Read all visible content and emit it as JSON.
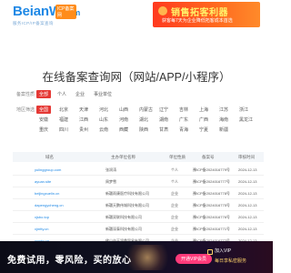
{
  "header": {
    "logo": "BeianW",
    "logo_suffix": ".com",
    "logo_tag": "ICP备案网",
    "logo_sub": "服务ICP/IP备案查询"
  },
  "top_banner": {
    "title": "销售拓客利器",
    "subtitle": "获客每7天为企业降低拓客成本首选"
  },
  "main_title": "在线备案查询网（网站/APP/小程序）",
  "filters": {
    "type_label": "备案性质",
    "types": [
      "全部",
      "个人",
      "企业",
      "事业单位"
    ],
    "region_label": "地区筛选",
    "regions": [
      "全国",
      "北京",
      "天津",
      "河北",
      "山西",
      "内蒙古",
      "辽宁",
      "吉林",
      "上海",
      "江苏",
      "浙江",
      "安徽",
      "福建",
      "江西",
      "山东",
      "河南",
      "湖北",
      "湖南",
      "广东",
      "广西",
      "海南",
      "黑龙江",
      "重庆",
      "四川",
      "贵州",
      "云南",
      "西藏",
      "陕西",
      "甘肃",
      "青海",
      "宁夏",
      "新疆"
    ]
  },
  "table": {
    "headers": [
      "域名",
      "主办单位名称",
      "单位性质",
      "备案号",
      "审核时间"
    ],
    "rows": [
      {
        "domain": "yulinggroup.com",
        "name": "张润涛",
        "type": "个人",
        "icp": "豫ICP备2024016779号",
        "time": "2024-12-13"
      },
      {
        "domain": "ayuan.site",
        "name": "周梦雪",
        "type": "个人",
        "icp": "豫ICP备2024016777号",
        "time": "2024-12-13"
      },
      {
        "domain": "beijingxuelin.cn",
        "name": "新疆雨康医疗科技有限公司",
        "type": "企业",
        "icp": "豫ICP备2024016778号",
        "time": "2024-12-13"
      },
      {
        "domain": "dapengycheng.cn",
        "name": "新疆天鹏伟城科技有限公司",
        "type": "企业",
        "icp": "豫ICP备2024016775号",
        "time": "2024-12-13"
      },
      {
        "domain": "xjsbo.top",
        "name": "新疆双联科技有限公司",
        "type": "企业",
        "icp": "豫ICP备2024016776号",
        "time": "2024-12-13"
      },
      {
        "domain": "xjmtty.cn",
        "name": "新疆深泰科技有限公司",
        "type": "企业",
        "icp": "豫ICP备2024016771号",
        "time": "2024-12-13"
      },
      {
        "domain": "yumin.cn",
        "name": "佛山市天润鼎贸易有限公司",
        "type": "企业",
        "icp": "豫ICP备2024016772号",
        "time": "2024-12-13"
      }
    ]
  },
  "bottom_ad": {
    "left_text": "免费试用，零风险，买的放心",
    "button": "开通VIP会员",
    "right_line1": "加入VIP",
    "right_line2": "每日享私密服务"
  }
}
